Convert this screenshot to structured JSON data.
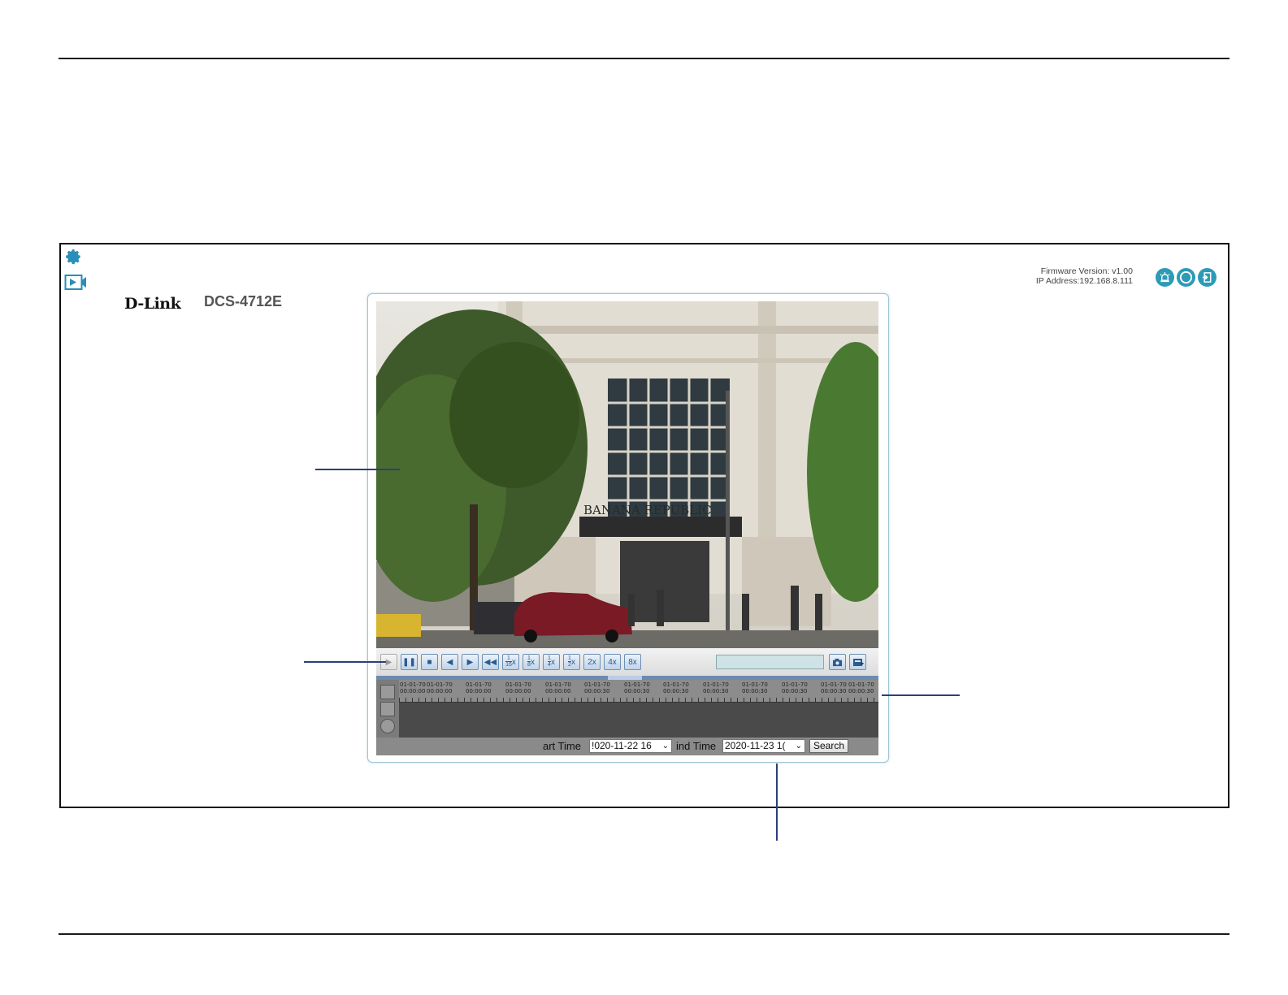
{
  "brand": {
    "logo": "D-Link",
    "model": "DCS-4712E"
  },
  "header": {
    "firmware": "Firmware Version: v1.00",
    "ip": "IP Address:192.168.8.111",
    "icons": [
      "alarm-icon",
      "record-icon",
      "logout-icon"
    ]
  },
  "sidebar": {
    "icons": [
      "settings-gear-icon",
      "playback-icon"
    ]
  },
  "playback": {
    "controls": {
      "play": "play-icon",
      "pause": "pause-icon",
      "stop": "stop-icon",
      "prev_frame": "step-back-icon",
      "next_frame": "step-forward-icon",
      "rewind": "rewind-icon",
      "speeds": [
        {
          "num": "1",
          "den": "16",
          "suffix": "x"
        },
        {
          "num": "1",
          "den": "8",
          "suffix": "x"
        },
        {
          "num": "1",
          "den": "4",
          "suffix": "x"
        },
        {
          "num": "1",
          "den": "2",
          "suffix": "x"
        }
      ],
      "fast_speeds": [
        "2x",
        "4x",
        "8x"
      ],
      "snapshot": "camera-icon",
      "save_clip": "save-clip-icon"
    },
    "timeline": {
      "ticks": [
        {
          "date": "01-01-70",
          "time": "00:00:00"
        },
        {
          "date": "01-01-70",
          "time": "00:00:00"
        },
        {
          "date": "01-01-70",
          "time": "00:00:00"
        },
        {
          "date": "01-01-70",
          "time": "00:00:00"
        },
        {
          "date": "01-01-70",
          "time": "00:00:00"
        },
        {
          "date": "01-01-70",
          "time": "00:00:30"
        },
        {
          "date": "01-01-70",
          "time": "00:00:30"
        },
        {
          "date": "01-01-70",
          "time": "00:00:30"
        },
        {
          "date": "01-01-70",
          "time": "00:00:30"
        },
        {
          "date": "01-01-70",
          "time": "00:00:30"
        },
        {
          "date": "01-01-70",
          "time": "00:00:30"
        },
        {
          "date": "01-01-70",
          "time": "00:00:30"
        },
        {
          "date": "01-01-70",
          "time": "00:00:30"
        }
      ]
    },
    "search": {
      "start_label": "art Time",
      "start_value": "!020-11-22 16",
      "end_label": "ind Time",
      "end_value": "2020-11-23 1(",
      "button": "Search"
    }
  }
}
